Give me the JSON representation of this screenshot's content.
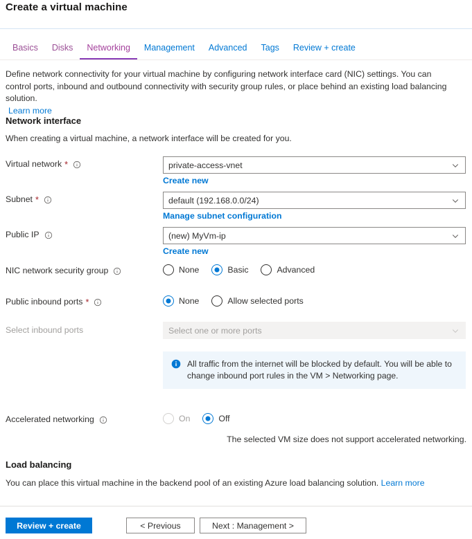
{
  "blade": {
    "title": "Create a virtual machine"
  },
  "tabs": [
    {
      "label": "Basics",
      "state": "visited"
    },
    {
      "label": "Disks",
      "state": "visited"
    },
    {
      "label": "Networking",
      "state": "active"
    },
    {
      "label": "Management",
      "state": "link"
    },
    {
      "label": "Advanced",
      "state": "link"
    },
    {
      "label": "Tags",
      "state": "link"
    },
    {
      "label": "Review + create",
      "state": "link"
    }
  ],
  "intro": {
    "paragraph": "Define network connectivity for your virtual machine by configuring network interface card (NIC) settings. You can control ports, inbound and outbound connectivity with security group rules, or place behind an existing load balancing solution.",
    "learn_more": "Learn more"
  },
  "network_interface": {
    "heading": "Network interface",
    "subtext": "When creating a virtual machine, a network interface will be created for you.",
    "virtual_network": {
      "label": "Virtual network",
      "required": "*",
      "value": "private-access-vnet",
      "sublink": "Create new"
    },
    "subnet": {
      "label": "Subnet",
      "required": "*",
      "value": "default (192.168.0.0/24)",
      "sublink": "Manage subnet configuration"
    },
    "public_ip": {
      "label": "Public IP",
      "value": "(new) MyVm-ip",
      "sublink": "Create new"
    },
    "nic_nsg": {
      "label": "NIC network security group",
      "options": [
        {
          "label": "None",
          "selected": false,
          "disabled": false
        },
        {
          "label": "Basic",
          "selected": true,
          "disabled": false
        },
        {
          "label": "Advanced",
          "selected": false,
          "disabled": false
        }
      ]
    },
    "public_inbound_ports": {
      "label": "Public inbound ports",
      "required": "*",
      "options": [
        {
          "label": "None",
          "selected": true,
          "disabled": false
        },
        {
          "label": "Allow selected ports",
          "selected": false,
          "disabled": false
        }
      ]
    },
    "select_inbound_ports": {
      "label": "Select inbound ports",
      "placeholder": "Select one or more ports",
      "disabled": true
    },
    "info_message": "All traffic from the internet will be blocked by default. You will be able to change inbound port rules in the VM > Networking page.",
    "accelerated_networking": {
      "label": "Accelerated networking",
      "options": [
        {
          "label": "On",
          "selected": false,
          "disabled": true
        },
        {
          "label": "Off",
          "selected": true,
          "disabled": false
        }
      ],
      "note": "The selected VM size does not support accelerated networking."
    }
  },
  "load_balancing": {
    "heading": "Load balancing",
    "subtext": "You can place this virtual machine in the backend pool of an existing Azure load balancing solution.",
    "learn_more": "Learn more"
  },
  "footer": {
    "review_create": "Review + create",
    "previous": "< Previous",
    "next": "Next : Management >"
  },
  "colors": {
    "accent": "#0078d4",
    "active_tab": "#873ab5",
    "visited_tab": "#9b4f96",
    "required": "#a4262c",
    "info_bg": "#eff6fc",
    "disabled_bg": "#f3f2f1"
  }
}
